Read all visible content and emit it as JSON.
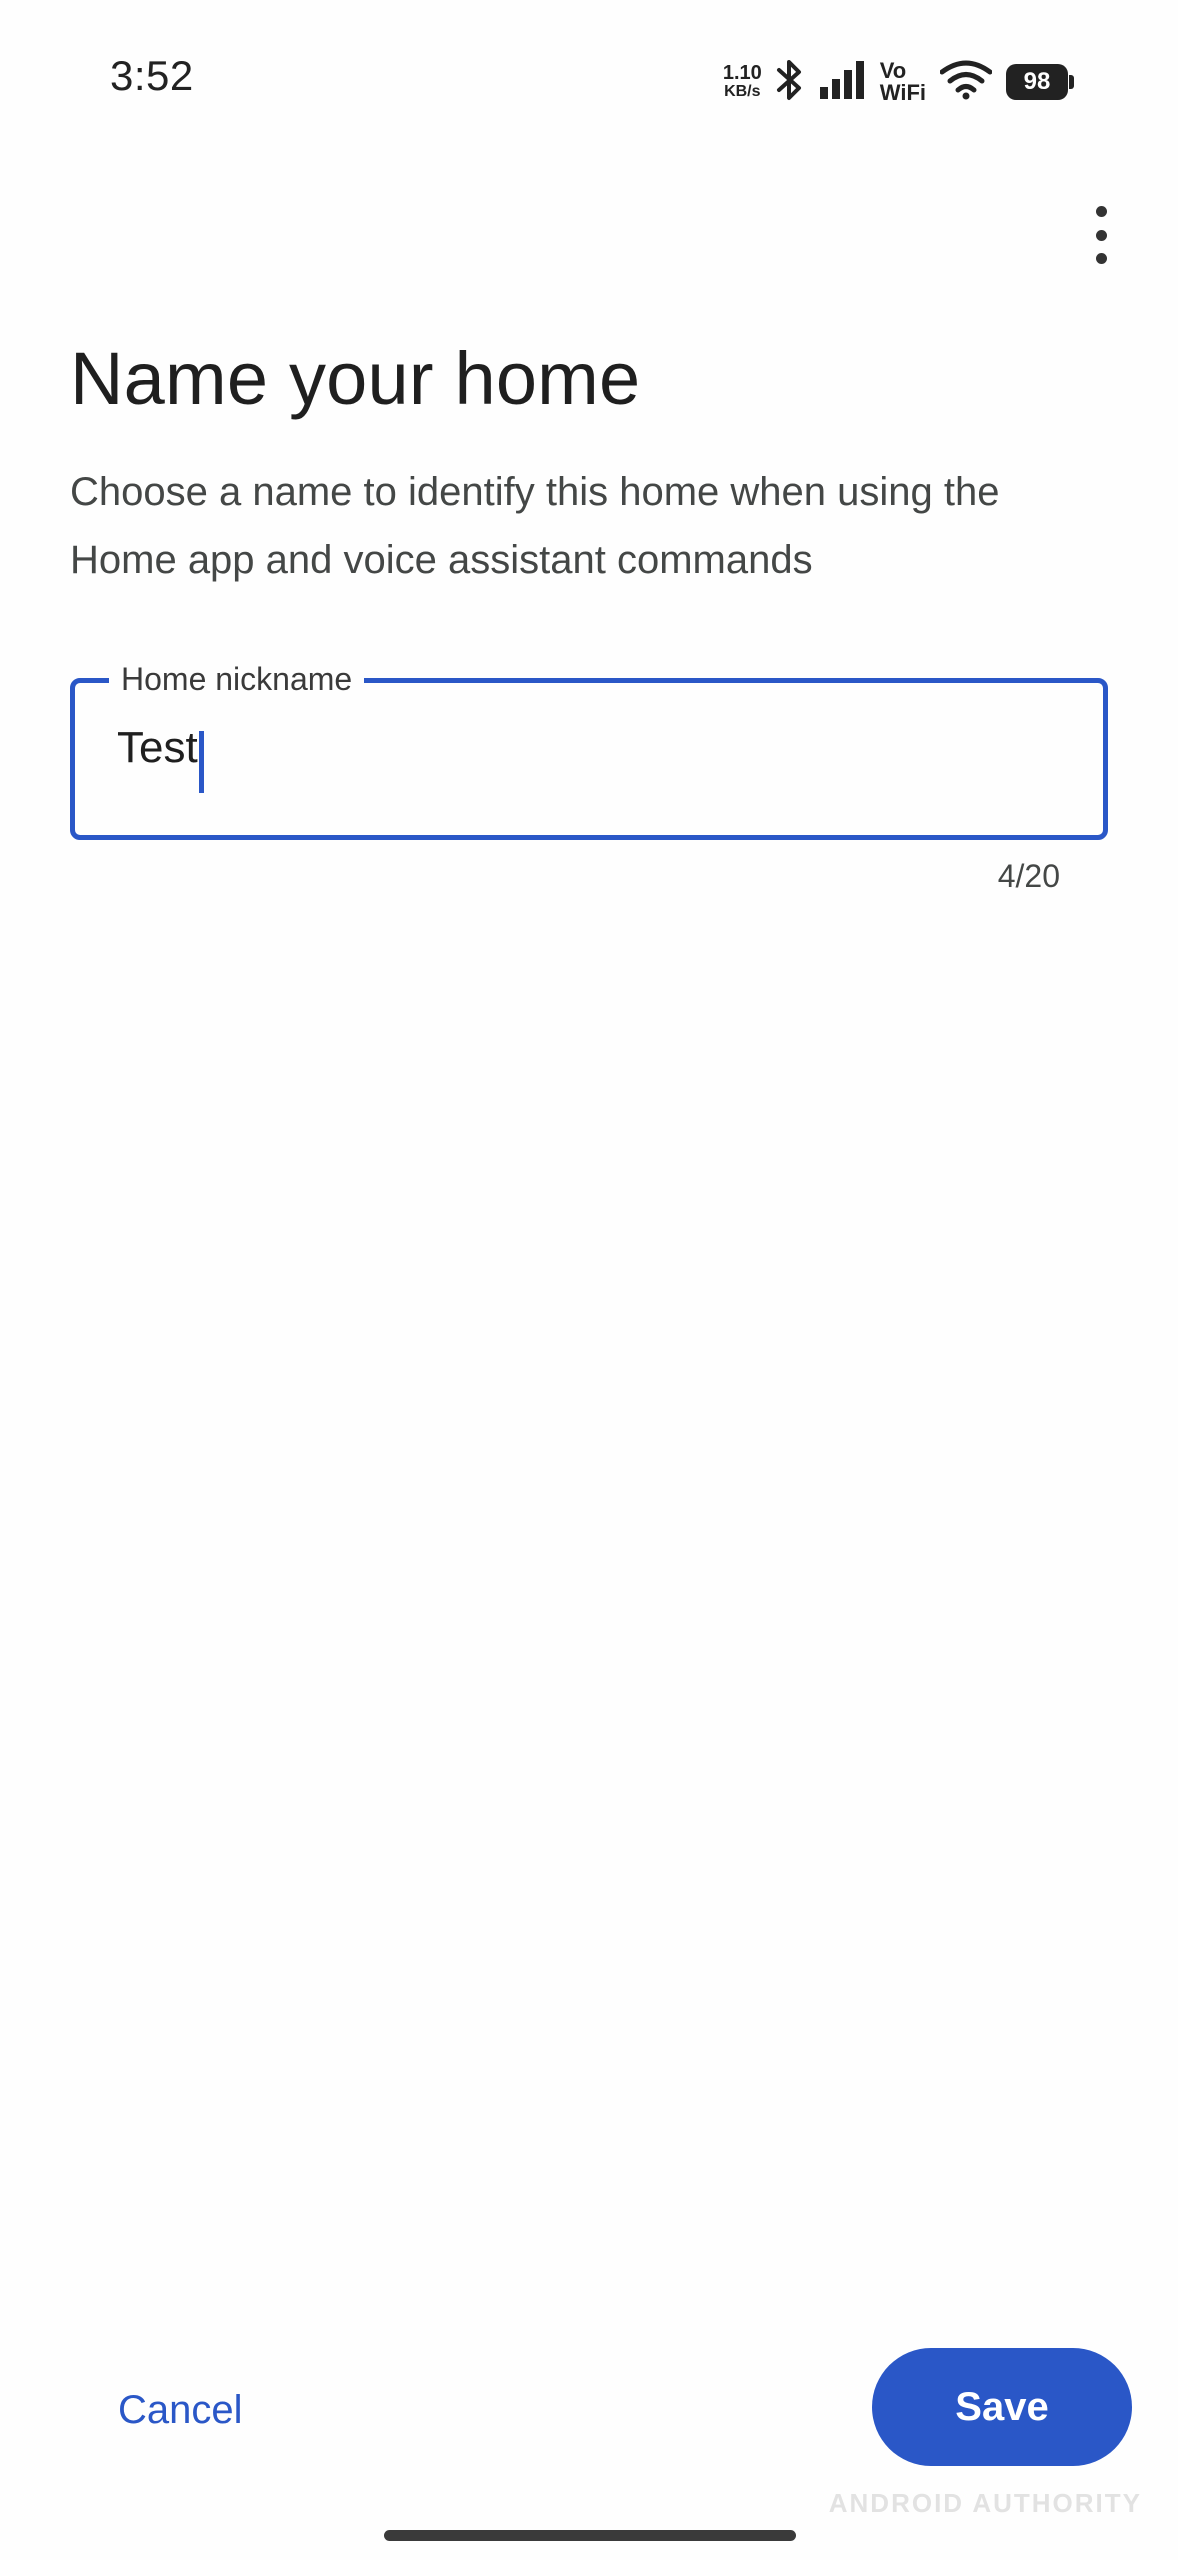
{
  "status_bar": {
    "time": "3:52",
    "net_speed_value": "1.10",
    "net_speed_unit": "KB/s",
    "vowifi_top": "Vo",
    "vowifi_bottom": "WiFi",
    "battery": "98",
    "icons": [
      "bluetooth-icon",
      "signal-icon",
      "wifi-icon"
    ]
  },
  "toolbar": {
    "overflow_icon": "more-vert-icon"
  },
  "header": {
    "title": "Name your home",
    "description": "Choose a name to identify this home when using the Home app and voice assistant commands"
  },
  "form": {
    "field_label": "Home nickname",
    "field_value": "Test",
    "counter": "4/20"
  },
  "actions": {
    "cancel_label": "Cancel",
    "save_label": "Save"
  },
  "watermark": "ANDROID AUTHORITY",
  "colors": {
    "accent": "#2a57c7",
    "background": "#fefefe",
    "text_primary": "#1f1f1f",
    "text_secondary": "#444746"
  }
}
